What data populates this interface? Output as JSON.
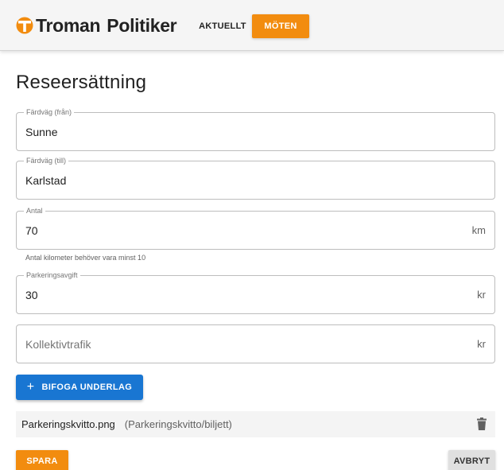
{
  "header": {
    "brand": "Troman",
    "product": "Politiker",
    "logo_color": "#f28c0f",
    "nav": [
      {
        "label": "AKTUELLT",
        "active": false
      },
      {
        "label": "MÖTEN",
        "active": true
      }
    ]
  },
  "page": {
    "title": "Reseersättning"
  },
  "form": {
    "from": {
      "label": "Färdväg (från)",
      "value": "Sunne"
    },
    "to": {
      "label": "Färdväg (till)",
      "value": "Karlstad"
    },
    "distance": {
      "label": "Antal",
      "value": "70",
      "suffix": "km",
      "helper": "Antal kilometer behöver vara minst 10"
    },
    "parking": {
      "label": "Parkeringsavgift",
      "value": "30",
      "suffix": "kr"
    },
    "transit": {
      "placeholder": "Kollektivtrafik",
      "value": "",
      "suffix": "kr"
    }
  },
  "attach_button": {
    "label": "BIFOGA UNDERLAG",
    "icon": "plus-icon"
  },
  "attachments": [
    {
      "filename": "Parkeringskvitto.png",
      "type": "(Parkeringskvitto/biljett)",
      "icon": "trash-icon"
    }
  ],
  "actions": {
    "save": "SPARA",
    "cancel": "AVBRYT"
  },
  "colors": {
    "accent": "#f28c0f",
    "primary": "#1976d2"
  }
}
